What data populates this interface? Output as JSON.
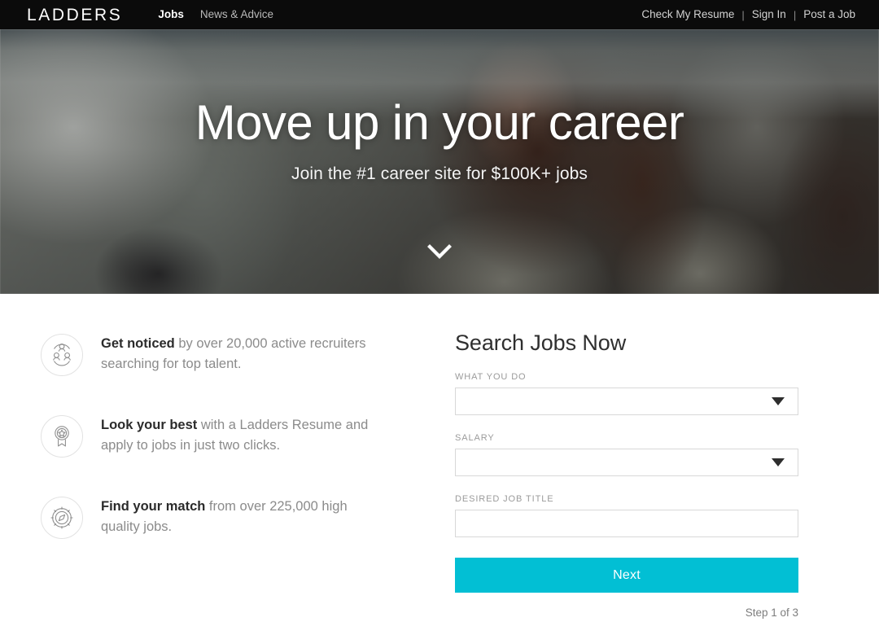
{
  "nav": {
    "logo": "LADDERS",
    "left_links": [
      {
        "label": "Jobs",
        "name": "nav-link-jobs",
        "active": true
      },
      {
        "label": "News & Advice",
        "name": "nav-link-news-advice",
        "active": false
      }
    ],
    "right_links": [
      {
        "label": "Check My Resume",
        "name": "nav-link-check-my-resume"
      },
      {
        "label": "Sign In",
        "name": "nav-link-sign-in"
      },
      {
        "label": "Post a Job",
        "name": "nav-link-post-a-job"
      }
    ],
    "separator": "|",
    "background_color": "#0b0b0b"
  },
  "hero": {
    "title": "Move up in your career",
    "subtitle": "Join the #1 career site for $100K+ jobs",
    "scroll_icon": "chevron-down-icon"
  },
  "features": [
    {
      "icon": "people-group-icon",
      "bold": "Get noticed",
      "rest": " by over 20,000 active recruiters searching for top talent."
    },
    {
      "icon": "award-badge-icon",
      "bold": "Look your best",
      "rest": " with a Ladders Resume and apply to jobs in just two clicks."
    },
    {
      "icon": "compass-icon",
      "bold": "Find your match",
      "rest": " from over 225,000 high quality jobs."
    }
  ],
  "search": {
    "title": "Search Jobs Now",
    "fields": [
      {
        "label": "WHAT YOU DO",
        "type": "select",
        "value": "",
        "name": "what-you-do-select"
      },
      {
        "label": "SALARY",
        "type": "select",
        "value": "",
        "name": "salary-select"
      },
      {
        "label": "DESIRED JOB TITLE",
        "type": "text",
        "value": "",
        "placeholder": "",
        "name": "desired-job-title-input"
      }
    ],
    "next_label": "Next",
    "next_color": "#02bfd4",
    "step_text": "Step 1 of 3"
  }
}
